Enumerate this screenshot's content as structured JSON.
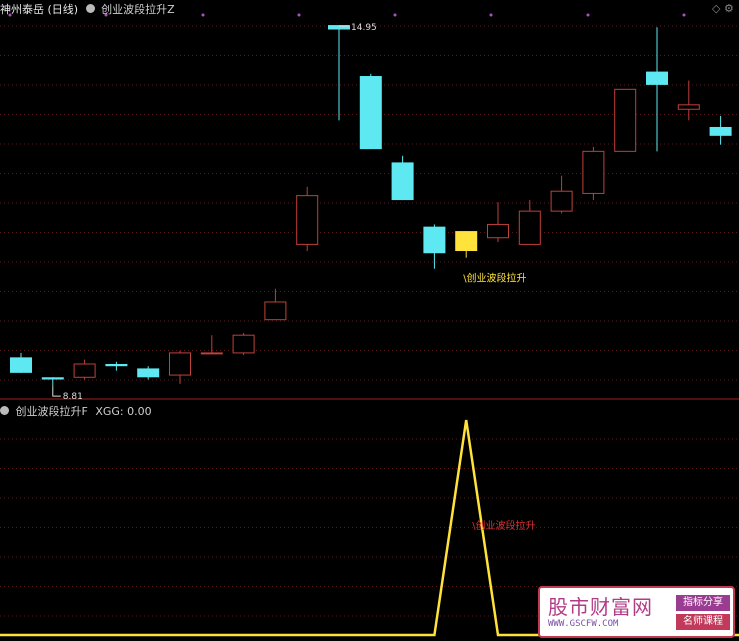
{
  "header": {
    "title": "神州泰岳 (日线)",
    "indicator_name": "创业波段拉升Z"
  },
  "sub_header": {
    "indicator_name": "创业波段拉升F",
    "value_label": "XGG: 0.00"
  },
  "chart_data": [
    {
      "type": "candlestick",
      "title": "神州泰岳 (日线)",
      "ylim": [
        6.6,
        15.2
      ],
      "candles": [
        {
          "o": 7.45,
          "h": 7.55,
          "l": 7.1,
          "c": 7.1,
          "color": "cyan"
        },
        {
          "o": 7.0,
          "h": 7.0,
          "l": 6.8,
          "c": 6.95,
          "color": "cyan"
        },
        {
          "o": 7.0,
          "h": 7.4,
          "l": 6.95,
          "c": 7.3,
          "color": "red"
        },
        {
          "o": 7.3,
          "h": 7.35,
          "l": 7.15,
          "c": 7.25,
          "color": "cyan"
        },
        {
          "o": 7.2,
          "h": 7.25,
          "l": 6.95,
          "c": 7.0,
          "color": "cyan"
        },
        {
          "o": 7.05,
          "h": 7.6,
          "l": 6.85,
          "c": 7.55,
          "color": "red"
        },
        {
          "o": 7.55,
          "h": 7.95,
          "l": 7.55,
          "c": 7.55,
          "color": "red"
        },
        {
          "o": 7.55,
          "h": 8.0,
          "l": 7.5,
          "c": 7.95,
          "color": "red"
        },
        {
          "o": 8.3,
          "h": 9.0,
          "l": 8.3,
          "c": 8.7,
          "color": "red"
        },
        {
          "o": 10.0,
          "h": 11.3,
          "l": 9.85,
          "c": 11.1,
          "color": "red"
        },
        {
          "o": 14.95,
          "h": 14.95,
          "l": 12.8,
          "c": 14.85,
          "color": "cyan"
        },
        {
          "o": 13.8,
          "h": 13.85,
          "l": 12.15,
          "c": 12.15,
          "color": "cyan"
        },
        {
          "o": 11.85,
          "h": 12.0,
          "l": 11.0,
          "c": 11.0,
          "color": "cyan"
        },
        {
          "o": 10.4,
          "h": 10.45,
          "l": 9.45,
          "c": 9.8,
          "color": "cyan"
        },
        {
          "o": 10.3,
          "h": 10.3,
          "l": 9.7,
          "c": 9.85,
          "color": "yellow"
        },
        {
          "o": 10.15,
          "h": 10.95,
          "l": 10.05,
          "c": 10.45,
          "color": "red"
        },
        {
          "o": 10.0,
          "h": 11.0,
          "l": 10.0,
          "c": 10.75,
          "color": "red"
        },
        {
          "o": 10.75,
          "h": 11.55,
          "l": 10.7,
          "c": 11.2,
          "color": "red"
        },
        {
          "o": 11.15,
          "h": 12.2,
          "l": 11.0,
          "c": 12.1,
          "color": "red"
        },
        {
          "o": 12.1,
          "h": 13.3,
          "l": 12.1,
          "c": 13.5,
          "color": "red"
        },
        {
          "o": 13.6,
          "h": 14.9,
          "l": 12.1,
          "c": 13.9,
          "color": "cyan"
        },
        {
          "o": 13.05,
          "h": 13.7,
          "l": 12.8,
          "c": 13.15,
          "color": "red"
        },
        {
          "o": 12.65,
          "h": 12.9,
          "l": 12.25,
          "c": 12.45,
          "color": "cyan"
        }
      ],
      "annotations": [
        {
          "text": "14.95",
          "candle": 10
        },
        {
          "text": "8.81",
          "candle": 1
        },
        {
          "text": "创业波段拉升",
          "candle": 14
        }
      ]
    },
    {
      "type": "line",
      "title": "创业波段拉升F",
      "series": [
        {
          "name": "XGG",
          "values": [
            0,
            0,
            0,
            0,
            0,
            0,
            0,
            0,
            0,
            0,
            0,
            0,
            0,
            0,
            1,
            0,
            0,
            0,
            0,
            0,
            0,
            0,
            0
          ]
        }
      ],
      "annotations": [
        {
          "text": "创业波段拉升",
          "candle": 14
        }
      ]
    }
  ],
  "watermark": {
    "title": "股市财富网",
    "url": "WWW.GSCFW.COM",
    "tag1": "指标分享",
    "tag2": "名师课程"
  },
  "colors": {
    "up": "#c0403a",
    "down": "#5ee9f2",
    "signal": "#ffe23a",
    "divider": "#a0201c",
    "grid": "#5a1a1a"
  }
}
